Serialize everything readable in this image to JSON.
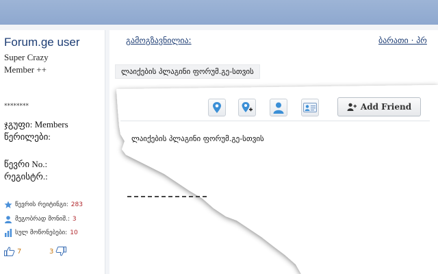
{
  "sidebar": {
    "username": "Forum.ge user",
    "rank_line1": "Super Crazy",
    "rank_line2": "Member ++",
    "stars": "********",
    "group_label": "ჯგუფი: Members",
    "posts_label": "წერილები:",
    "member_no_label": "წევრი No.:",
    "registered_label": "რეგისტრ.:",
    "stats": [
      {
        "label": "წევრის რეიტინგი:",
        "value": "283",
        "icon": "star-icon"
      },
      {
        "label": "მეგობრად მონიშ.:",
        "value": "3",
        "icon": "user-icon"
      },
      {
        "label": "სულ მოწონებები:",
        "value": "10",
        "icon": "bar-chart-icon"
      }
    ],
    "thumbs_up_count": "7",
    "thumbs_down_count": "3"
  },
  "main": {
    "nav_left": "გამოგზავნილია:",
    "nav_right": "ბარათი · პრ",
    "post_text": "ლაიქების პლაგინი ფორუმ.გე-სთვის"
  },
  "popup": {
    "add_friend_label": "Add Friend",
    "text": "ლაიქების პლაგინი ფორუმ.გე-სთვის",
    "icons": [
      "location-pin-icon",
      "add-location-icon",
      "user-profile-icon",
      "id-card-icon",
      "add-user-icon"
    ]
  },
  "colors": {
    "topbar": "#9db4d6",
    "link": "#1d3d74",
    "stat_value": "#b0262b",
    "vote_count": "#c77a16",
    "icon_blue": "#3b8fd6"
  }
}
